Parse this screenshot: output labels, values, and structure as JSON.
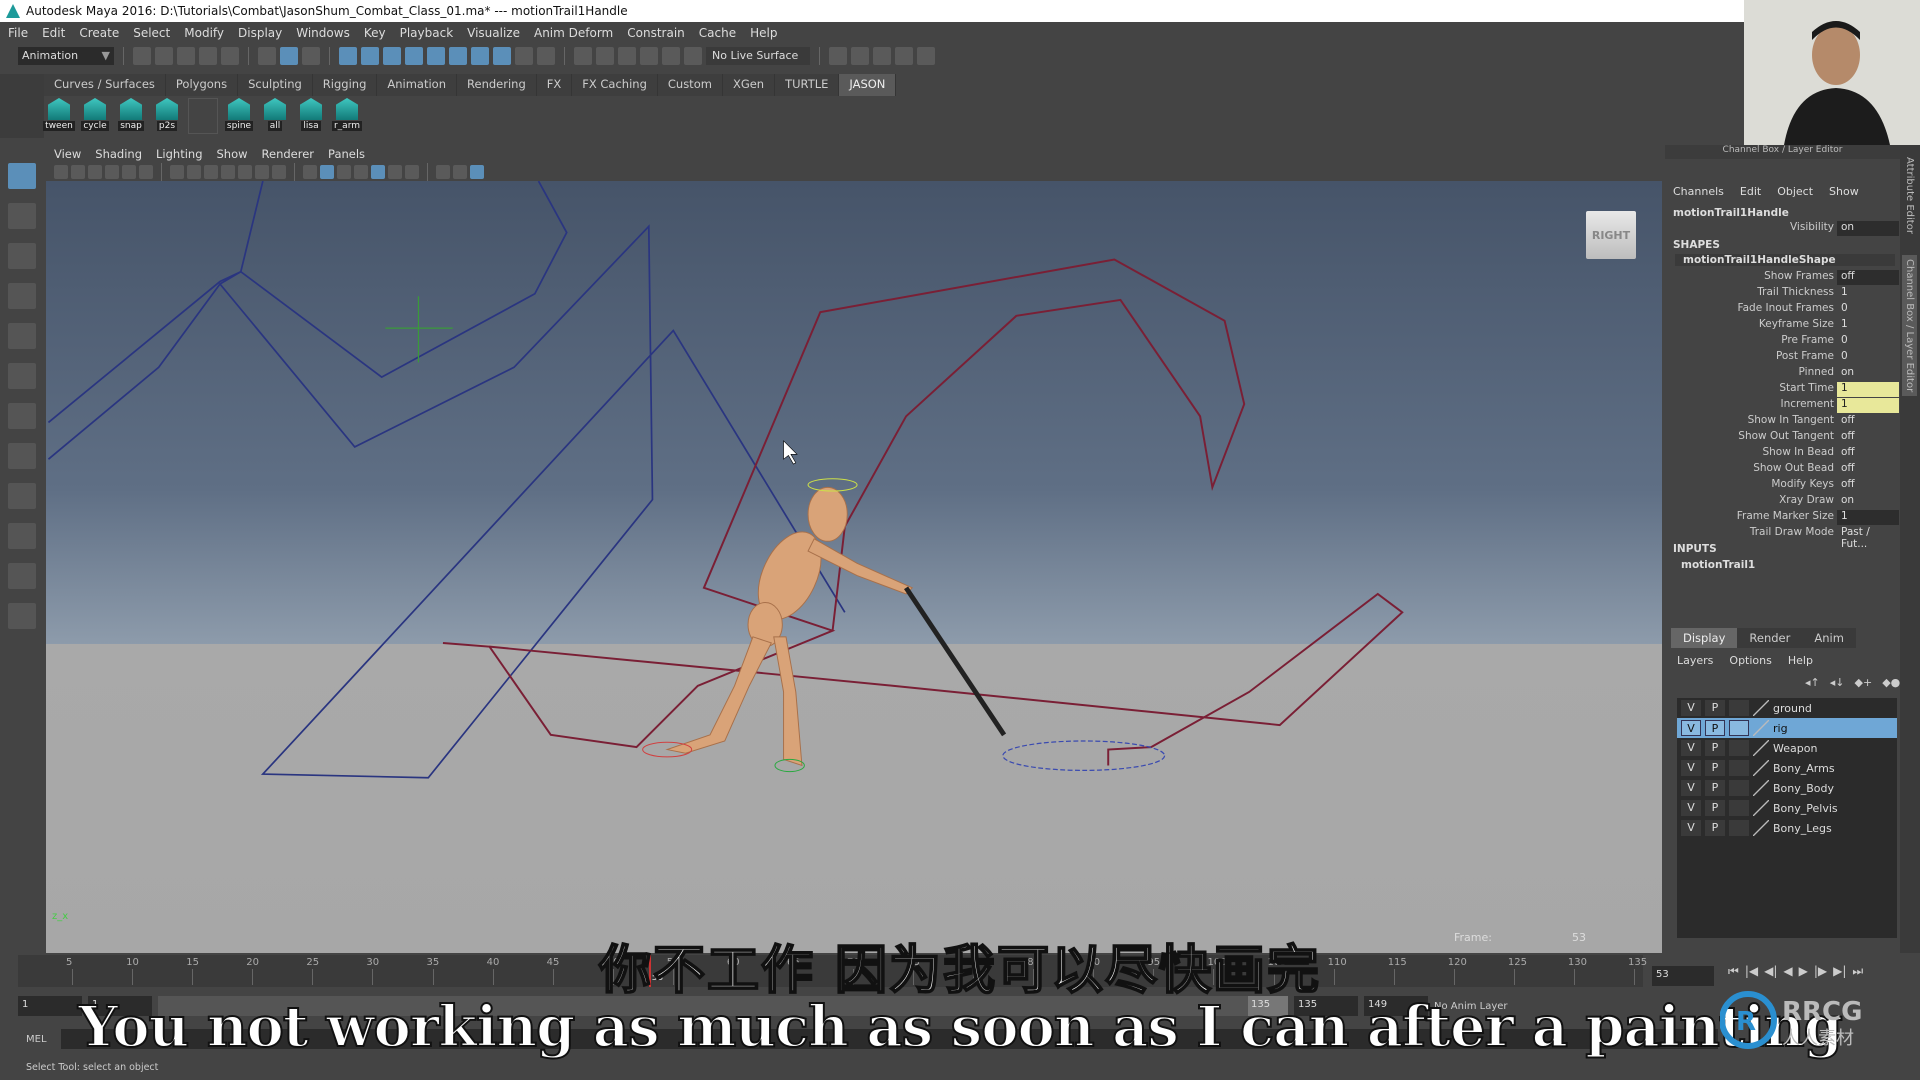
{
  "window": {
    "title": "Autodesk Maya 2016: D:\\Tutorials\\Combat\\JasonShum_Combat_Class_01.ma*  ---  motionTrail1Handle"
  },
  "menubar": [
    "File",
    "Edit",
    "Create",
    "Select",
    "Modify",
    "Display",
    "Windows",
    "Key",
    "Playback",
    "Visualize",
    "Anim Deform",
    "Constrain",
    "Cache",
    "Help"
  ],
  "statusline": {
    "menuset": "Animation",
    "live_surface": "No Live Surface"
  },
  "shelf": {
    "tabs": [
      "Curves / Surfaces",
      "Polygons",
      "Sculpting",
      "Rigging",
      "Animation",
      "Rendering",
      "FX",
      "FX Caching",
      "Custom",
      "XGen",
      "TURTLE",
      "JASON"
    ],
    "active_tab": "JASON",
    "buttons": [
      "tween",
      "cycle",
      "snap",
      "p2s",
      "",
      "spine",
      "all",
      "lisa",
      "r_arm"
    ]
  },
  "viewport": {
    "menu": [
      "View",
      "Shading",
      "Lighting",
      "Show",
      "Renderer",
      "Panels"
    ],
    "viewcube": "RIGHT",
    "frame_label": "Frame:",
    "frame_value": "53",
    "colors": {
      "trail_blue": "#2a3580",
      "trail_red": "#7a1f35",
      "character": "#d9a378"
    }
  },
  "channelbox": {
    "header": "Channel Box / Layer Editor",
    "menu": [
      "Channels",
      "Edit",
      "Object",
      "Show"
    ],
    "object": "motionTrail1Handle",
    "visibility": {
      "label": "Visibility",
      "value": "on"
    },
    "shapes_label": "SHAPES",
    "shape_name": "motionTrail1HandleShape",
    "attributes": [
      {
        "label": "Show Frames",
        "value": "off",
        "style": "dark"
      },
      {
        "label": "Trail Thickness",
        "value": "1"
      },
      {
        "label": "Fade Inout Frames",
        "value": "0"
      },
      {
        "label": "Keyframe Size",
        "value": "1"
      },
      {
        "label": "Pre Frame",
        "value": "0"
      },
      {
        "label": "Post Frame",
        "value": "0"
      },
      {
        "label": "Pinned",
        "value": "on"
      },
      {
        "label": "Start Time",
        "value": "1",
        "style": "yel"
      },
      {
        "label": "Increment",
        "value": "1",
        "style": "yel"
      },
      {
        "label": "Show In Tangent",
        "value": "off"
      },
      {
        "label": "Show Out Tangent",
        "value": "off"
      },
      {
        "label": "Show In Bead",
        "value": "off"
      },
      {
        "label": "Show Out Bead",
        "value": "off"
      },
      {
        "label": "Modify Keys",
        "value": "off"
      },
      {
        "label": "Xray Draw",
        "value": "on"
      },
      {
        "label": "Frame Marker Size",
        "value": "1",
        "style": "dark"
      },
      {
        "label": "Trail Draw Mode",
        "value": "Past / Fut..."
      }
    ],
    "inputs_label": "INPUTS",
    "input_name": "motionTrail1"
  },
  "side_tabs": [
    "Attribute Editor",
    "Channel Box / Layer Editor"
  ],
  "layer_editor": {
    "tabs": [
      "Display",
      "Render",
      "Anim"
    ],
    "menu": [
      "Layers",
      "Options",
      "Help"
    ],
    "layers": [
      {
        "v": "V",
        "p": "P",
        "name": "ground"
      },
      {
        "v": "V",
        "p": "P",
        "name": "rig",
        "selected": true
      },
      {
        "v": "V",
        "p": "P",
        "name": "Weapon"
      },
      {
        "v": "V",
        "p": "P",
        "name": "Bony_Arms"
      },
      {
        "v": "V",
        "p": "P",
        "name": "Bony_Body"
      },
      {
        "v": "V",
        "p": "P",
        "name": "Bony_Pelvis"
      },
      {
        "v": "V",
        "p": "P",
        "name": "Bony_Legs"
      }
    ]
  },
  "timeline": {
    "ticks": [
      "5",
      "10",
      "15",
      "20",
      "25",
      "30",
      "35",
      "40",
      "45",
      "50",
      "55",
      "60",
      "65",
      "70",
      "75",
      "80",
      "85",
      "90",
      "95",
      "100",
      "105",
      "110",
      "115",
      "120",
      "125",
      "130",
      "135"
    ],
    "current_frame": "53",
    "current_frame_field": "53"
  },
  "range": {
    "start": "1",
    "playback_start": "1",
    "slider_end": "135",
    "playback_end": "135",
    "end": "149",
    "anim_layer": "No Anim Layer"
  },
  "mel": {
    "label": "MEL"
  },
  "helpline": "Select Tool: select an object",
  "subtitles": {
    "chinese": "你不工作 因为我可以尽快画完",
    "english": "You not working as much as soon as I can after a painting"
  },
  "watermark_logo": {
    "text": "RRCG",
    "subtext": "人人素材"
  }
}
